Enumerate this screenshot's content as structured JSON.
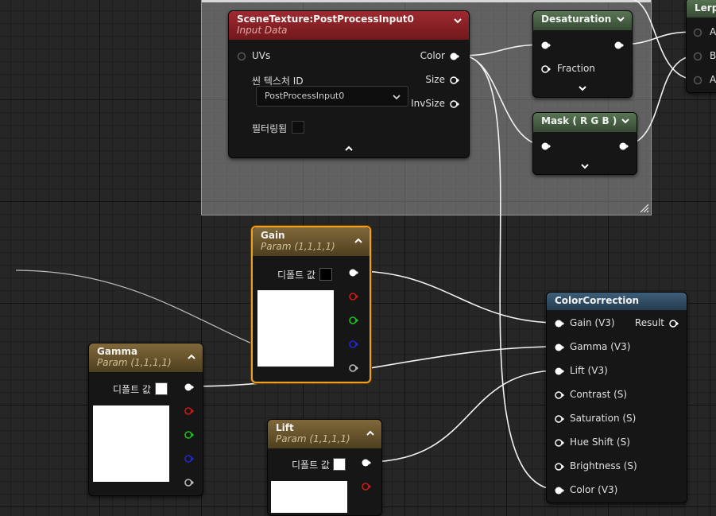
{
  "colors": {
    "accent_selection": "#f0a020",
    "header_red": "#9d2a2f",
    "header_gold": "#80683a",
    "header_green": "#597554",
    "header_blue": "#3e5e78",
    "pin_red": "#d01818",
    "pin_green": "#18c418",
    "pin_blue": "#2424d8"
  },
  "nodes": {
    "scene_texture": {
      "title": "SceneTexture:PostProcessInput0",
      "subtitle": "Input Data",
      "uvs_label": "UVs",
      "color_label": "Color",
      "size_label": "Size",
      "invsize_label": "InvSize",
      "scene_texture_id_label": "씬 텍스처 ID",
      "scene_texture_id_value": "PostProcessInput0",
      "filtered_label": "필터링됨"
    },
    "desaturation": {
      "title": "Desaturation",
      "fraction_label": "Fraction"
    },
    "mask": {
      "title": "Mask ( R G B )"
    },
    "lerp": {
      "title": "Lerp",
      "pin_a": "A",
      "pin_b": "B",
      "pin_alpha": "A"
    },
    "gain": {
      "title": "Gain",
      "subtitle": "Param (1,1,1,1)",
      "default_label": "디폴트 값",
      "default_color": "#000000"
    },
    "gamma": {
      "title": "Gamma",
      "subtitle": "Param (1,1,1,1)",
      "default_label": "디폴트 값",
      "default_color": "#ffffff"
    },
    "lift": {
      "title": "Lift",
      "subtitle": "Param (1,1,1,1)",
      "default_label": "디폴트 값",
      "default_color": "#ffffff"
    },
    "color_correction": {
      "title": "ColorCorrection",
      "result_label": "Result",
      "inputs": [
        "Gain (V3)",
        "Gamma (V3)",
        "Lift (V3)",
        "Contrast (S)",
        "Saturation (S)",
        "Hue Shift (S)",
        "Brightness (S)",
        "Color (V3)"
      ]
    }
  }
}
